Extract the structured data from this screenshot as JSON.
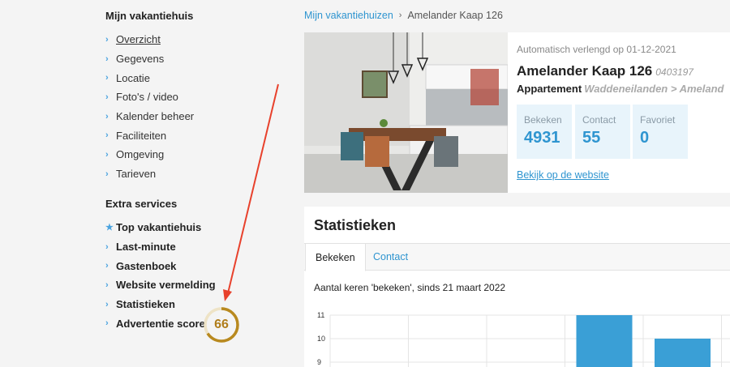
{
  "sidebar": {
    "heading": "Mijn vakantiehuis",
    "items": [
      {
        "label": "Overzicht",
        "active": true
      },
      {
        "label": "Gegevens"
      },
      {
        "label": "Locatie"
      },
      {
        "label": "Foto's / video"
      },
      {
        "label": "Kalender beheer"
      },
      {
        "label": "Faciliteiten"
      },
      {
        "label": "Omgeving"
      },
      {
        "label": "Tarieven"
      }
    ],
    "extra_heading": "Extra services",
    "extra_items": [
      {
        "label": "Top vakantiehuis",
        "icon": "star-icon"
      },
      {
        "label": "Last-minute",
        "icon": "chevron-right-icon"
      },
      {
        "label": "Gastenboek",
        "icon": "chevron-right-icon"
      },
      {
        "label": "Website vermelding",
        "icon": "chevron-right-icon"
      },
      {
        "label": "Statistieken",
        "icon": "chevron-right-icon"
      },
      {
        "label": "Advertentie score",
        "icon": "chevron-right-icon"
      }
    ],
    "score": "66",
    "score_fraction": 0.66,
    "score_color": "#b8891f"
  },
  "breadcrumb": {
    "link": "Mijn vakantiehuizen",
    "current": "Amelander Kaap 126"
  },
  "listing": {
    "renewal": "Automatisch verlengd op 01-12-2021",
    "title": "Amelander Kaap 126",
    "code": "0403197",
    "type": "Appartement",
    "location": "Waddeneilanden > Ameland",
    "stats": [
      {
        "label": "Bekeken",
        "value": "4931"
      },
      {
        "label": "Contact",
        "value": "55"
      },
      {
        "label": "Favoriet",
        "value": "0"
      }
    ],
    "website_link": "Bekijk op de website"
  },
  "statistics": {
    "title": "Statistieken",
    "tabs": [
      "Bekeken",
      "Contact"
    ],
    "caption": "Aantal keren 'bekeken', sinds 21 maart 2022"
  },
  "chart_data": {
    "type": "bar",
    "ylim": [
      9,
      11
    ],
    "yticks": [
      "11",
      "10",
      "9"
    ],
    "values": [
      0,
      0,
      0,
      11,
      10
    ],
    "grid": true,
    "color": "#3a9fd6"
  },
  "colors": {
    "accent": "#2f95d0",
    "arrow": "#e8412c"
  }
}
